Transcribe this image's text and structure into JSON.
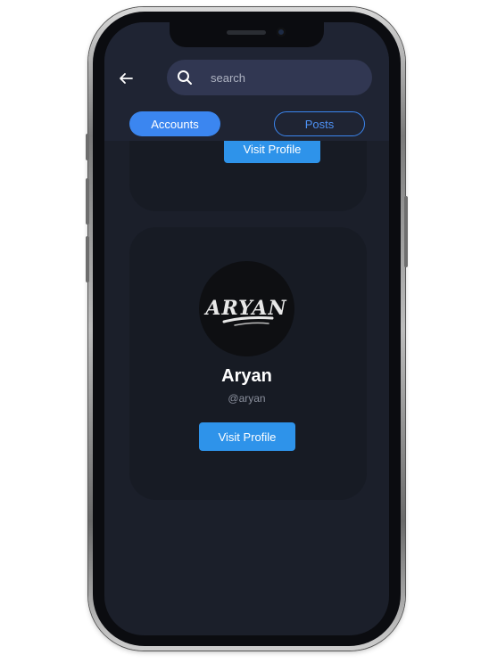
{
  "header": {
    "back_icon": "arrow-left-icon",
    "search": {
      "placeholder": "search",
      "value": "",
      "icon": "search-icon"
    },
    "tabs": [
      {
        "label": "Accounts",
        "active": true
      },
      {
        "label": "Posts",
        "active": false
      }
    ]
  },
  "results": [
    {
      "visit_label": "Visit Profile"
    },
    {
      "avatar_logo_text": "ARYAN",
      "name": "Aryan",
      "handle": "@aryan",
      "visit_label": "Visit Profile"
    }
  ],
  "colors": {
    "accent": "#3b86f0",
    "button": "#2e93ea",
    "background": "#1b1f2a",
    "card": "#171b24",
    "header": "#1f2433"
  }
}
